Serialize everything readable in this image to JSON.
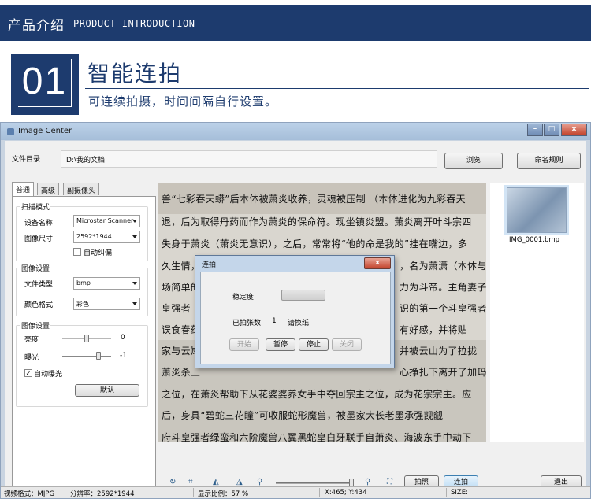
{
  "banner": {
    "title_cn": "产品介绍",
    "title_en": "PRODUCT INTRODUCTION"
  },
  "feature": {
    "number": "01",
    "title": "智能连拍",
    "subtitle": "可连续拍摄，时间间隔自行设置。"
  },
  "window": {
    "title": "Image Center",
    "controls": {
      "minimize": "–",
      "maximize": "□",
      "close": "x"
    }
  },
  "directory": {
    "label": "文件目录",
    "path": "D:\\我的文档",
    "browse_button": "浏览",
    "naming_button": "命名规则"
  },
  "tabs": [
    "普通",
    "高级",
    "副摄像头"
  ],
  "scan": {
    "group_title": "扫描模式",
    "device_label": "设备名称",
    "device_value": "Microstar Scanner",
    "size_label": "图像尺寸",
    "size_value": "2592*1944",
    "autocorrect_label": "自动纠偏",
    "autocorrect_checked": false
  },
  "image_settings": {
    "group_title": "图像设置",
    "filetype_label": "文件类型",
    "filetype_value": "bmp",
    "color_label": "颜色格式",
    "color_value": "彩色"
  },
  "adjust": {
    "group_title": "图像设置",
    "brightness_label": "亮度",
    "brightness_value": "0",
    "brightness_level": 0.5,
    "exposure_label": "曝光",
    "exposure_value": "-1",
    "exposure_level": 0.74,
    "auto_exposure_label": "自动曝光",
    "auto_exposure_checked": true,
    "default_button": "默认"
  },
  "document_lines": [
    "兽“七彩吞天蟒”后本体被萧炎收养，灵魂被压制 （本体进化为九彩吞天",
    "退，后为取得丹药而作为萧炎的保命符。现坐镇炎盟。萧炎离开叶斗宗四",
    "失身于萧炎（萧炎无意识），之后，常常将“他的命是我的”挂在嘴边，多",
    "久生情，",
    "场简单的",
    "皇强者（",
    "误食春药",
    "家与云岚",
    "萧炎杀上",
    "之位，在萧炎帮助下从花婆婆养女手中夺回宗主之位，成为花宗宗主。应",
    "后，身具“碧蛇三花瞳”可收服蛇形魔兽，被墨家大长老墨承强觊觎",
    "府斗皇强者绿蛮和六阶魔兽八翼黑蛇皇白牙联手自萧炎、海波东手中劫下"
  ],
  "document_right_fragments": [
    "，名为萧潇（本体与",
    "力为斗帝。主角妻子",
    "识的第一个斗皇强者",
    "有好感，并将贴",
    "并被云山为了拉拢",
    "心挣扎下离开了加玛"
  ],
  "dialog": {
    "title": "连拍",
    "close": "x",
    "stability_label": "稳定度",
    "stability_level": 0.0,
    "count_label": "已拍张数",
    "count_value": "1",
    "count_hint": "请换纸",
    "buttons": [
      "开始",
      "暂停",
      "停止",
      "关闭"
    ]
  },
  "thumbnail": {
    "filename": "IMG_0001.bmp"
  },
  "toolbar": {
    "icons": [
      "rotate-icon",
      "crop-icon",
      "rotate-left-icon",
      "rotate-right-icon",
      "zoom-out-icon",
      "zoom-in-icon",
      "fit-icon"
    ],
    "zoom_level": 0.93,
    "capture_button": "拍照",
    "burst_button": "连拍",
    "exit_button": "退出"
  },
  "status": {
    "format": "视频格式：MJPG",
    "resolution": "分辨率：2592*1944",
    "scale": "显示比例：57 %",
    "coords": "X:465; Y:434",
    "size": "SIZE:"
  },
  "colors": {
    "brand": "#1d3b6e",
    "window_frame": "#c9d4e1",
    "progress_green": "#3fb64a"
  }
}
